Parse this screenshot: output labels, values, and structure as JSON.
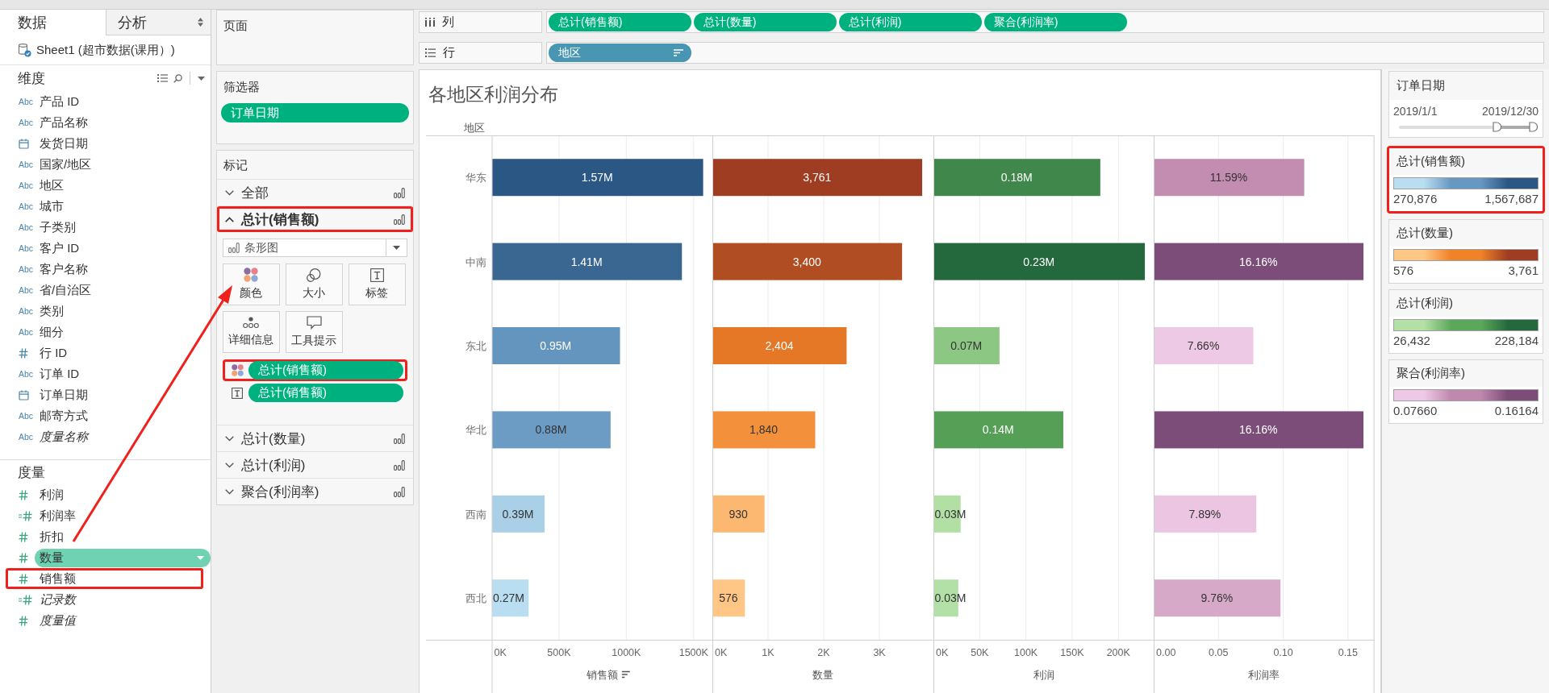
{
  "data_pane": {
    "tabs": [
      {
        "label": "数据",
        "selected": true
      },
      {
        "label": "分析",
        "selected": false
      }
    ],
    "datasource": "Sheet1 (超市数据(课用）)",
    "dimensions": {
      "title": "维度",
      "fields": [
        {
          "name": "产品 ID",
          "kind": "string",
          "type_label": "Abc",
          "generated": false
        },
        {
          "name": "产品名称",
          "kind": "string",
          "type_label": "Abc",
          "generated": false
        },
        {
          "name": "发货日期",
          "kind": "date",
          "generated": false
        },
        {
          "name": "国家/地区",
          "kind": "string",
          "type_label": "Abc",
          "generated": false
        },
        {
          "name": "地区",
          "kind": "string",
          "type_label": "Abc",
          "generated": false
        },
        {
          "name": "城市",
          "kind": "string",
          "type_label": "Abc",
          "generated": false
        },
        {
          "name": "子类别",
          "kind": "string",
          "type_label": "Abc",
          "generated": false
        },
        {
          "name": "客户 ID",
          "kind": "string",
          "type_label": "Abc",
          "generated": false
        },
        {
          "name": "客户名称",
          "kind": "string",
          "type_label": "Abc",
          "generated": false
        },
        {
          "name": "省/自治区",
          "kind": "string",
          "type_label": "Abc",
          "generated": false
        },
        {
          "name": "类别",
          "kind": "string",
          "type_label": "Abc",
          "generated": false
        },
        {
          "name": "细分",
          "kind": "string",
          "type_label": "Abc",
          "generated": false
        },
        {
          "name": "行 ID",
          "kind": "number",
          "generated": false
        },
        {
          "name": "订单 ID",
          "kind": "string",
          "type_label": "Abc",
          "generated": false
        },
        {
          "name": "订单日期",
          "kind": "date",
          "generated": false
        },
        {
          "name": "邮寄方式",
          "kind": "string",
          "type_label": "Abc",
          "generated": false
        },
        {
          "name": "度量名称",
          "kind": "string",
          "type_label": "Abc",
          "generated": true
        }
      ]
    },
    "measures": {
      "title": "度量",
      "fields": [
        {
          "name": "利润",
          "kind": "number",
          "generated": false,
          "selected": false,
          "highlighted": false
        },
        {
          "name": "利润率",
          "kind": "calculated",
          "generated": false,
          "selected": false,
          "highlighted": false
        },
        {
          "name": "折扣",
          "kind": "number",
          "generated": false,
          "selected": false,
          "highlighted": false
        },
        {
          "name": "数量",
          "kind": "number",
          "generated": false,
          "selected": true,
          "highlighted": false
        },
        {
          "name": "销售额",
          "kind": "number",
          "generated": false,
          "selected": false,
          "highlighted": true
        },
        {
          "name": "记录数",
          "kind": "calculated",
          "generated": true,
          "selected": false,
          "highlighted": false
        },
        {
          "name": "度量值",
          "kind": "number",
          "generated": true,
          "selected": false,
          "highlighted": false
        }
      ]
    }
  },
  "pages": {
    "title": "页面"
  },
  "filters": {
    "title": "筛选器",
    "pills": [
      {
        "label": "订单日期",
        "continuous": true
      }
    ]
  },
  "marks": {
    "title": "标记",
    "cards": [
      {
        "label": "全部",
        "expanded": false,
        "highlighted": false
      },
      {
        "label": "总计(销售额)",
        "expanded": true,
        "highlighted": true,
        "mark_type": "条形图",
        "properties": [
          {
            "kind": "color",
            "label": "颜色"
          },
          {
            "kind": "size",
            "label": "大小"
          },
          {
            "kind": "label",
            "label": "标签"
          },
          {
            "kind": "detail",
            "label": "详细信息"
          },
          {
            "kind": "tooltip",
            "label": "工具提示"
          }
        ],
        "pills": [
          {
            "kind": "color",
            "label": "总计(销售额)",
            "continuous": true,
            "highlighted": true
          },
          {
            "kind": "label",
            "label": "总计(销售额)",
            "continuous": true,
            "highlighted": false
          }
        ]
      },
      {
        "label": "总计(数量)",
        "expanded": false,
        "highlighted": false
      },
      {
        "label": "总计(利润)",
        "expanded": false,
        "highlighted": false
      },
      {
        "label": "聚合(利润率)",
        "expanded": false,
        "highlighted": false
      }
    ]
  },
  "shelves": [
    {
      "kind": "columns",
      "label": "列",
      "pills": [
        {
          "label": "总计(销售额)",
          "continuous": true,
          "sorted": false
        },
        {
          "label": "总计(数量)",
          "continuous": true,
          "sorted": false
        },
        {
          "label": "总计(利润)",
          "continuous": true,
          "sorted": false
        },
        {
          "label": "聚合(利润率)",
          "continuous": true,
          "sorted": false
        }
      ]
    },
    {
      "kind": "rows",
      "label": "行",
      "pills": [
        {
          "label": "地区",
          "continuous": false,
          "sorted": true
        }
      ]
    }
  ],
  "view": {
    "title": "各地区利润分布",
    "panes": [
      {
        "sorted": true,
        "chart_data": {
          "type": "bar",
          "orientation": "horizontal",
          "grid": true,
          "ylabel": "地区",
          "xlabel": "销售额",
          "categories": [
            "华东",
            "中南",
            "东北",
            "华北",
            "西南",
            "西北"
          ],
          "values": [
            1567687,
            1410000,
            950000,
            880000,
            390000,
            270876
          ],
          "xlim": [
            0,
            1640000
          ],
          "xticks": [
            {
              "value": 0,
              "label": "0K"
            },
            {
              "value": 500000,
              "label": "500K"
            },
            {
              "value": 1000000,
              "label": "1000K"
            },
            {
              "value": 1500000,
              "label": "1500K"
            }
          ],
          "value_labels": [
            "1.57M",
            "1.41M",
            "0.95M",
            "0.88M",
            "0.39M",
            "0.27M"
          ]
        }
      },
      {
        "chart_data": {
          "type": "bar",
          "orientation": "horizontal",
          "grid": true,
          "xlabel": "数量",
          "values": [
            3761,
            3400,
            2404,
            1840,
            930,
            576
          ],
          "xlim": [
            0,
            3965
          ],
          "xticks": [
            {
              "value": 0,
              "label": "0K"
            },
            {
              "value": 1000,
              "label": "1K"
            },
            {
              "value": 2000,
              "label": "2K"
            },
            {
              "value": 3000,
              "label": "3K"
            }
          ],
          "value_labels": [
            "3,761",
            "3,400",
            "2,404",
            "1,840",
            "930",
            "576"
          ]
        }
      },
      {
        "chart_data": {
          "type": "bar",
          "orientation": "horizontal",
          "grid": true,
          "xlabel": "利润",
          "values": [
            180000,
            228184,
            71000,
            140000,
            29000,
            26432
          ],
          "xlim": [
            0,
            238700
          ],
          "xticks": [
            {
              "value": 0,
              "label": "0K"
            },
            {
              "value": 50000,
              "label": "50K"
            },
            {
              "value": 100000,
              "label": "100K"
            },
            {
              "value": 150000,
              "label": "150K"
            },
            {
              "value": 200000,
              "label": "200K"
            }
          ],
          "value_labels": [
            "0.18M",
            "0.23M",
            "0.07M",
            "0.14M",
            "0.03M",
            "0.03M"
          ]
        }
      },
      {
        "chart_data": {
          "type": "bar",
          "orientation": "horizontal",
          "grid": true,
          "xlabel": "利润率",
          "values": [
            0.1159,
            0.16164,
            0.0766,
            0.1616,
            0.0789,
            0.0976
          ],
          "xlim": [
            0,
            0.1704
          ],
          "xticks": [
            {
              "value": 0,
              "label": "0.00"
            },
            {
              "value": 0.05,
              "label": "0.05"
            },
            {
              "value": 0.1,
              "label": "0.10"
            },
            {
              "value": 0.15,
              "label": "0.15"
            }
          ],
          "value_labels": [
            "11.59%",
            "16.16%",
            "7.66%",
            "16.16%",
            "7.89%",
            "9.76%"
          ]
        }
      }
    ]
  },
  "legends": {
    "filter": {
      "title": "订单日期",
      "start": "2019/1/1",
      "end": "2019/12/30",
      "handles": [
        {
          "level": 0.72
        },
        {
          "level": 1
        }
      ]
    },
    "color_legends": [
      {
        "title": "总计(销售额)",
        "min_label": "270,876",
        "max_label": "1,567,687",
        "ramp": [
          {
            "color": "#b9ddf1"
          },
          {
            "color": "#6798c1"
          },
          {
            "color": "#2a5783"
          }
        ],
        "highlighted": true
      },
      {
        "title": "总计(数量)",
        "min_label": "576",
        "max_label": "3,761",
        "ramp": [
          {
            "color": "#ffc685"
          },
          {
            "color": "#f08228"
          },
          {
            "color": "#9e3d22"
          }
        ],
        "highlighted": false
      },
      {
        "title": "总计(利润)",
        "min_label": "26,432",
        "max_label": "228,184",
        "ramp": [
          {
            "color": "#b3e0a6"
          },
          {
            "color": "#5ca85a"
          },
          {
            "color": "#24693d"
          }
        ],
        "highlighted": false
      },
      {
        "title": "聚合(利润率)",
        "min_label": "0.07660",
        "max_label": "0.16164",
        "ramp": [
          {
            "color": "#eec9e5"
          },
          {
            "color": "#bf88ad"
          },
          {
            "color": "#7c4d79"
          }
        ],
        "highlighted": false
      }
    ]
  }
}
